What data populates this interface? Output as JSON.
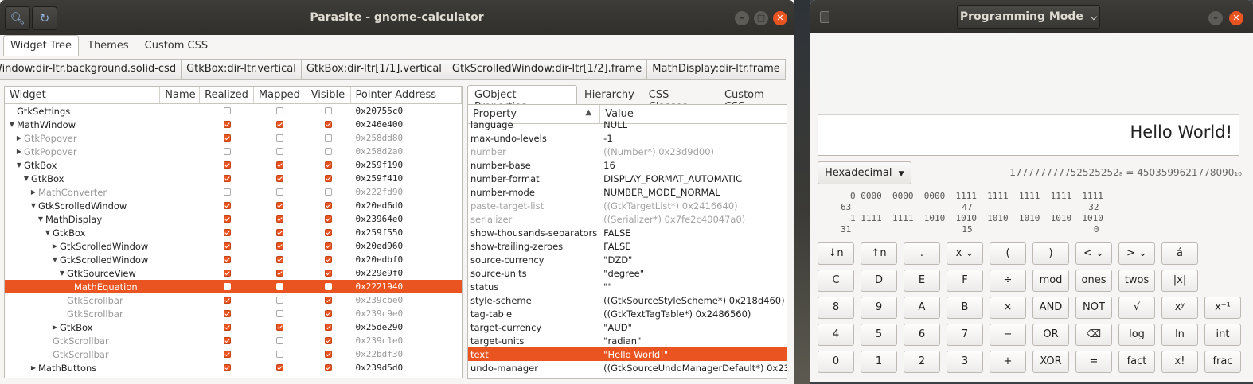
{
  "parasite": {
    "title": "Parasite - gnome-calculator",
    "header_icons": [
      "inspect-icon",
      "refresh-icon"
    ],
    "tabs": [
      {
        "label": "Widget Tree",
        "active": true
      },
      {
        "label": "Themes",
        "active": false
      },
      {
        "label": "Custom CSS",
        "active": false
      }
    ],
    "breadcrumbs": [
      "Window:dir-ltr.background.solid-csd",
      "GtkBox:dir-ltr.vertical",
      "GtkBox:dir-ltr[1/1].vertical",
      "GtkScrolledWindow:dir-ltr[1/2].frame",
      "MathDisplay:dir-ltr.frame"
    ],
    "tree": {
      "columns": [
        "Widget",
        "Name",
        "Realized",
        "Mapped",
        "Visible",
        "Pointer Address"
      ],
      "rows": [
        {
          "indent": 0,
          "arrow": "",
          "label": "GtkSettings",
          "r": false,
          "m": false,
          "v": false,
          "addr": "0x20755c0",
          "dim": false,
          "sel": false
        },
        {
          "indent": 0,
          "arrow": "down",
          "label": "MathWindow",
          "r": true,
          "m": true,
          "v": true,
          "addr": "0x246e400",
          "dim": false,
          "sel": false
        },
        {
          "indent": 1,
          "arrow": "right",
          "label": "GtkPopover",
          "r": true,
          "m": false,
          "v": false,
          "addr": "0x258dd80",
          "dim": true,
          "sel": false
        },
        {
          "indent": 1,
          "arrow": "right",
          "label": "GtkPopover",
          "r": false,
          "m": false,
          "v": false,
          "addr": "0x258d2a0",
          "dim": true,
          "sel": false
        },
        {
          "indent": 1,
          "arrow": "down",
          "label": "GtkBox",
          "r": true,
          "m": true,
          "v": true,
          "addr": "0x259f190",
          "dim": false,
          "sel": false
        },
        {
          "indent": 2,
          "arrow": "down",
          "label": "GtkBox",
          "r": true,
          "m": true,
          "v": true,
          "addr": "0x259f410",
          "dim": false,
          "sel": false
        },
        {
          "indent": 3,
          "arrow": "right",
          "label": "MathConverter",
          "r": false,
          "m": false,
          "v": false,
          "addr": "0x222fd90",
          "dim": true,
          "sel": false
        },
        {
          "indent": 3,
          "arrow": "down",
          "label": "GtkScrolledWindow",
          "r": true,
          "m": true,
          "v": true,
          "addr": "0x20ed6d0",
          "dim": false,
          "sel": false
        },
        {
          "indent": 4,
          "arrow": "down",
          "label": "MathDisplay",
          "r": true,
          "m": true,
          "v": true,
          "addr": "0x23964e0",
          "dim": false,
          "sel": false
        },
        {
          "indent": 5,
          "arrow": "down",
          "label": "GtkBox",
          "r": true,
          "m": true,
          "v": true,
          "addr": "0x259f550",
          "dim": false,
          "sel": false
        },
        {
          "indent": 6,
          "arrow": "right",
          "label": "GtkScrolledWindow",
          "r": true,
          "m": true,
          "v": true,
          "addr": "0x20ed960",
          "dim": false,
          "sel": false
        },
        {
          "indent": 6,
          "arrow": "down",
          "label": "GtkScrolledWindow",
          "r": true,
          "m": true,
          "v": true,
          "addr": "0x20edbf0",
          "dim": false,
          "sel": false
        },
        {
          "indent": 7,
          "arrow": "down",
          "label": "GtkSourceView",
          "r": true,
          "m": true,
          "v": true,
          "addr": "0x229e9f0",
          "dim": false,
          "sel": false
        },
        {
          "indent": 8,
          "arrow": "",
          "label": "MathEquation",
          "r": false,
          "m": false,
          "v": false,
          "addr": "0x2221940",
          "dim": false,
          "sel": true
        },
        {
          "indent": 7,
          "arrow": "",
          "label": "GtkScrollbar",
          "r": true,
          "m": false,
          "v": true,
          "addr": "0x239cbe0",
          "dim": true,
          "sel": false
        },
        {
          "indent": 7,
          "arrow": "",
          "label": "GtkScrollbar",
          "r": true,
          "m": false,
          "v": true,
          "addr": "0x239c9e0",
          "dim": true,
          "sel": false
        },
        {
          "indent": 6,
          "arrow": "right",
          "label": "GtkBox",
          "r": true,
          "m": true,
          "v": true,
          "addr": "0x25de290",
          "dim": false,
          "sel": false
        },
        {
          "indent": 5,
          "arrow": "",
          "label": "GtkScrollbar",
          "r": true,
          "m": false,
          "v": true,
          "addr": "0x239c1e0",
          "dim": true,
          "sel": false
        },
        {
          "indent": 5,
          "arrow": "",
          "label": "GtkScrollbar",
          "r": true,
          "m": false,
          "v": true,
          "addr": "0x22bdf30",
          "dim": true,
          "sel": false
        },
        {
          "indent": 3,
          "arrow": "right",
          "label": "MathButtons",
          "r": true,
          "m": true,
          "v": true,
          "addr": "0x239d5d0",
          "dim": false,
          "sel": false
        }
      ]
    },
    "prop_tabs": [
      {
        "label": "GObject Properties",
        "active": true
      },
      {
        "label": "Hierarchy",
        "active": false
      },
      {
        "label": "CSS Classes",
        "active": false
      },
      {
        "label": "Custom CSS",
        "active": false
      }
    ],
    "props": {
      "columns": [
        "Property",
        "Value"
      ],
      "sort_indicator": "▲",
      "rows": [
        {
          "k": "language",
          "v": "NULL",
          "dim": false,
          "sel": false,
          "cut": true
        },
        {
          "k": "max-undo-levels",
          "v": "-1",
          "dim": false,
          "sel": false
        },
        {
          "k": "number",
          "v": "((Number*) 0x23d9d00)",
          "dim": true,
          "sel": false
        },
        {
          "k": "number-base",
          "v": "16",
          "dim": false,
          "sel": false
        },
        {
          "k": "number-format",
          "v": "DISPLAY_FORMAT_AUTOMATIC",
          "dim": false,
          "sel": false
        },
        {
          "k": "number-mode",
          "v": "NUMBER_MODE_NORMAL",
          "dim": false,
          "sel": false
        },
        {
          "k": "paste-target-list",
          "v": "((GtkTargetList*) 0x2416640)",
          "dim": true,
          "sel": false
        },
        {
          "k": "serializer",
          "v": "((Serializer*) 0x7fe2c40047a0)",
          "dim": true,
          "sel": false
        },
        {
          "k": "show-thousands-separators",
          "v": "FALSE",
          "dim": false,
          "sel": false
        },
        {
          "k": "show-trailing-zeroes",
          "v": "FALSE",
          "dim": false,
          "sel": false
        },
        {
          "k": "source-currency",
          "v": "\"DZD\"",
          "dim": false,
          "sel": false
        },
        {
          "k": "source-units",
          "v": "\"degree\"",
          "dim": false,
          "sel": false
        },
        {
          "k": "status",
          "v": "\"\"",
          "dim": false,
          "sel": false
        },
        {
          "k": "style-scheme",
          "v": "((GtkSourceStyleScheme*) 0x218d460)",
          "dim": false,
          "sel": false
        },
        {
          "k": "tag-table",
          "v": "((GtkTextTagTable*) 0x2486560)",
          "dim": false,
          "sel": false
        },
        {
          "k": "target-currency",
          "v": "\"AUD\"",
          "dim": false,
          "sel": false
        },
        {
          "k": "target-units",
          "v": "\"radian\"",
          "dim": false,
          "sel": false
        },
        {
          "k": "text",
          "v": "\"Hello World!\"",
          "dim": false,
          "sel": true
        },
        {
          "k": "undo-manager",
          "v": "((GtkSourceUndoManagerDefault*) 0x23c",
          "dim": false,
          "sel": false
        }
      ]
    }
  },
  "calculator": {
    "title": "Programming Mode",
    "display_text": "Hello World!",
    "base": "Hexadecimal",
    "conversion": "177777777752525252₈ = 4503599621778090₁₀",
    "bits_line1": "0 0000  0000  0000  1111  1111  1111  1111  1111",
    "bits_idx1": "63                     47                      32",
    "bits_line2": "1 1111  1111  1010  1010  1010  1010  1010  1010",
    "bits_idx2": "31                     15                       0",
    "keys": [
      [
        "↓n",
        "↑n",
        ".",
        "x ⌄",
        "(",
        ")",
        "< ⌄",
        "> ⌄",
        "á",
        ""
      ],
      [
        "C",
        "D",
        "E",
        "F",
        "÷",
        "mod",
        "ones",
        "twos",
        "|x|",
        ""
      ],
      [
        "8",
        "9",
        "A",
        "B",
        "×",
        "AND",
        "NOT",
        "√",
        "xʸ",
        "x⁻¹"
      ],
      [
        "4",
        "5",
        "6",
        "7",
        "−",
        "OR",
        "⌫",
        "log",
        "ln",
        "int"
      ],
      [
        "0",
        "1",
        "2",
        "3",
        "+",
        "XOR",
        "=",
        "fact",
        "x!",
        "frac"
      ]
    ]
  },
  "colors": {
    "accent": "#e95420",
    "titlebar": "#353431"
  }
}
